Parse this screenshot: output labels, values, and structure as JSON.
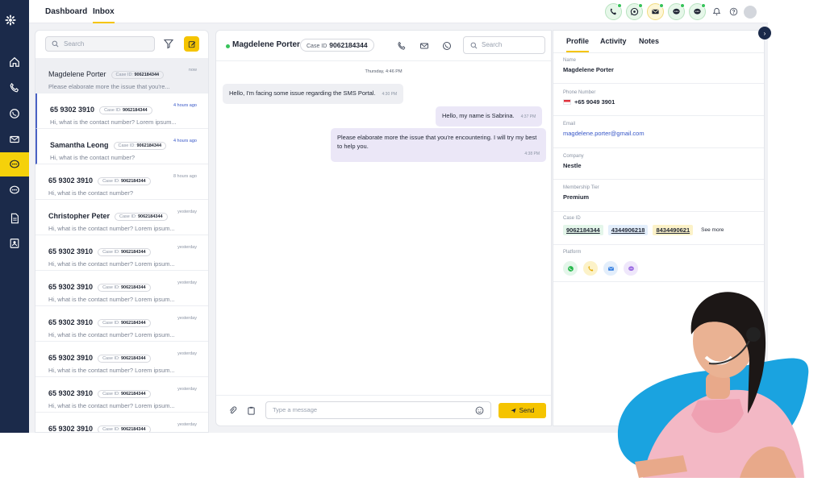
{
  "topbar": {
    "tabs": [
      {
        "label": "Dashboard",
        "active": false
      },
      {
        "label": "Inbox",
        "active": true
      }
    ],
    "channel_icons": [
      "phone-icon",
      "whatsapp-icon",
      "mail-icon",
      "chat-icon",
      "chat-icon"
    ],
    "utility_icons": [
      "bell-icon",
      "help-icon",
      "user-avatar"
    ]
  },
  "sidebar": {
    "items": [
      {
        "icon": "home-icon",
        "active": false
      },
      {
        "icon": "phone-icon",
        "active": false
      },
      {
        "icon": "whatsapp-icon",
        "active": false
      },
      {
        "icon": "mail-icon",
        "active": false
      },
      {
        "icon": "chat-icon",
        "active": true
      },
      {
        "icon": "messenger-icon",
        "active": false
      },
      {
        "icon": "report-icon",
        "active": false
      },
      {
        "icon": "contact-icon",
        "active": false
      }
    ]
  },
  "conv": {
    "search_placeholder": "Search",
    "items": [
      {
        "name": "Magdelene Porter",
        "case_label": "Case ID:",
        "case_id": "9062184344",
        "time": "now",
        "preview": "Please elaborate more the issue that you're...",
        "selected": true,
        "unread": false
      },
      {
        "name": "65 9302 3910",
        "case_label": "Case ID:",
        "case_id": "9062184344",
        "time": "4 hours ago",
        "preview": "Hi, what is the contact number? Lorem ipsum...",
        "selected": false,
        "unread": true
      },
      {
        "name": "Samantha Leong",
        "case_label": "Case ID:",
        "case_id": "9062184344",
        "time": "4 hours ago",
        "preview": "Hi, what is the contact number?",
        "selected": false,
        "unread": true
      },
      {
        "name": "65 9302 3910",
        "case_label": "Case ID:",
        "case_id": "9062184344",
        "time": "8 hours ago",
        "preview": "Hi, what is the contact number?",
        "selected": false,
        "unread": false
      },
      {
        "name": "Christopher Peter",
        "case_label": "Case ID:",
        "case_id": "9062184344",
        "time": "yesterday",
        "preview": "Hi, what is the contact number? Lorem ipsum...",
        "selected": false,
        "unread": false
      },
      {
        "name": "65 9302 3910",
        "case_label": "Case ID:",
        "case_id": "9062184344",
        "time": "yesterday",
        "preview": "Hi, what is the contact number? Lorem ipsum...",
        "selected": false,
        "unread": false
      },
      {
        "name": "65 9302 3910",
        "case_label": "Case ID:",
        "case_id": "9062184344",
        "time": "yesterday",
        "preview": "Hi, what is the contact number? Lorem ipsum...",
        "selected": false,
        "unread": false
      },
      {
        "name": "65 9302 3910",
        "case_label": "Case ID:",
        "case_id": "9062184344",
        "time": "yesterday",
        "preview": "Hi, what is the contact number? Lorem ipsum...",
        "selected": false,
        "unread": false
      },
      {
        "name": "65 9302 3910",
        "case_label": "Case ID:",
        "case_id": "9062184344",
        "time": "yesterday",
        "preview": "Hi, what is the contact number? Lorem ipsum...",
        "selected": false,
        "unread": false
      },
      {
        "name": "65 9302 3910",
        "case_label": "Case ID:",
        "case_id": "9062184344",
        "time": "yesterday",
        "preview": "Hi, what is the contact number? Lorem ipsum...",
        "selected": false,
        "unread": false
      },
      {
        "name": "65 9302 3910",
        "case_label": "Case ID:",
        "case_id": "9062184344",
        "time": "yesterday",
        "preview": "Hi, what is the contact number? Lorem ipsum...",
        "selected": false,
        "unread": false
      }
    ]
  },
  "chat": {
    "name": "Magdelene Porter",
    "case_label": "Case ID",
    "case_id": "9062184344",
    "search_placeholder": "Search",
    "date_separator": "Thursday, 4:46 PM",
    "messages": [
      {
        "text": "Hello, I'm facing some issue regarding the SMS Portal.",
        "time": "4:30 PM",
        "direction": "in"
      },
      {
        "text": "Hello, my name is Sabrina.",
        "time": "4:37 PM",
        "direction": "out"
      },
      {
        "text": "Please elaborate more the issue that you're encountering. I will try my best to help you.",
        "time": "4:38 PM",
        "direction": "out"
      }
    ],
    "composer_placeholder": "Type a message",
    "send_label": "Send"
  },
  "profile": {
    "tabs": [
      {
        "label": "Profile",
        "active": true
      },
      {
        "label": "Activity",
        "active": false
      },
      {
        "label": "Notes",
        "active": false
      }
    ],
    "name_label": "Name",
    "name": "Magdelene Porter",
    "phone_label": "Phone Number",
    "phone": "+65 9049 3901",
    "email_label": "Email",
    "email": "magdelene.porter@gmail.com",
    "company_label": "Company",
    "company": "Nestle",
    "tier_label": "Membership Tier",
    "tier": "Premium",
    "case_label": "Case ID",
    "case_ids": [
      "9062184344",
      "4344906218",
      "8434490621"
    ],
    "see_more": "See more",
    "platform_label": "Platform",
    "platforms": [
      "whatsapp-icon",
      "phone-icon",
      "mail-icon",
      "messenger-icon"
    ]
  },
  "colors": {
    "rail": "#1b2a4a",
    "accent": "#f5c400",
    "online": "#37c35a",
    "link": "#3555c7",
    "outgoing_bubble": "#ebe7f7",
    "agent_blob": "#1aa3e0"
  }
}
